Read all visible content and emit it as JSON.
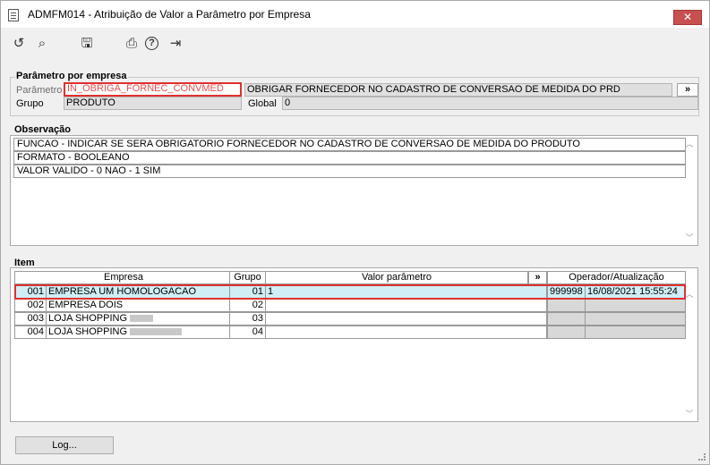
{
  "window": {
    "title": "ADMFM014 - Atribuição de Valor a Parâmetro por Empresa",
    "close_glyph": "✕"
  },
  "toolbar": {
    "icons": [
      "undo-icon",
      "search-icon",
      "save-icon",
      "print-icon",
      "help-icon",
      "exit-icon"
    ],
    "glyphs": {
      "undo": "↺",
      "search": "⌕",
      "save": "🖫",
      "print": "⎙",
      "help": "?",
      "exit": "⇥"
    }
  },
  "parametro_section": {
    "legend": "Parâmetro por empresa",
    "parametro_label": "Parâmetro",
    "parametro_value": "IN_OBRIGA_FORNEC_CONVMED",
    "descricao_value": "OBRIGAR FORNECEDOR NO CADASTRO DE CONVERSAO DE MEDIDA DO PRD",
    "lookup_button": "»",
    "grupo_label": "Grupo",
    "grupo_value": "PRODUTO",
    "global_label": "Global",
    "global_value": "0"
  },
  "observacao_section": {
    "legend": "Observação",
    "lines": [
      "FUNCAO - INDICAR SE SERA OBRIGATORIO FORNECEDOR NO CADASTRO DE CONVERSAO DE MEDIDA DO PRODUTO",
      "FORMATO - BOOLEANO",
      "VALOR VALIDO - 0  NAO - 1 SIM"
    ]
  },
  "item_section": {
    "legend": "Item",
    "columns": {
      "empresa": "Empresa",
      "grupo": "Grupo",
      "valor": "Valor parâmetro",
      "expand": "»",
      "operador": "Operador/Atualização"
    },
    "rows": [
      {
        "code": "001",
        "name": "EMPRESA UM HOMOLOGACAO",
        "grupo": "01",
        "valor": "1",
        "operador": "999998",
        "atualizacao": "16/08/2021 15:55:24"
      },
      {
        "code": "002",
        "name": "EMPRESA DOIS",
        "grupo": "02",
        "valor": "",
        "operador": "",
        "atualizacao": ""
      },
      {
        "code": "003",
        "name": "LOJA SHOPPING",
        "grupo": "03",
        "valor": "",
        "operador": "",
        "atualizacao": ""
      },
      {
        "code": "004",
        "name": "LOJA SHOPPING",
        "grupo": "04",
        "valor": "",
        "operador": "",
        "atualizacao": ""
      }
    ]
  },
  "footer": {
    "log_button": "Log..."
  },
  "colors": {
    "highlight_border": "#e03030",
    "selected_row": "#cfeef6",
    "readonly_field": "#e0e0e0"
  }
}
